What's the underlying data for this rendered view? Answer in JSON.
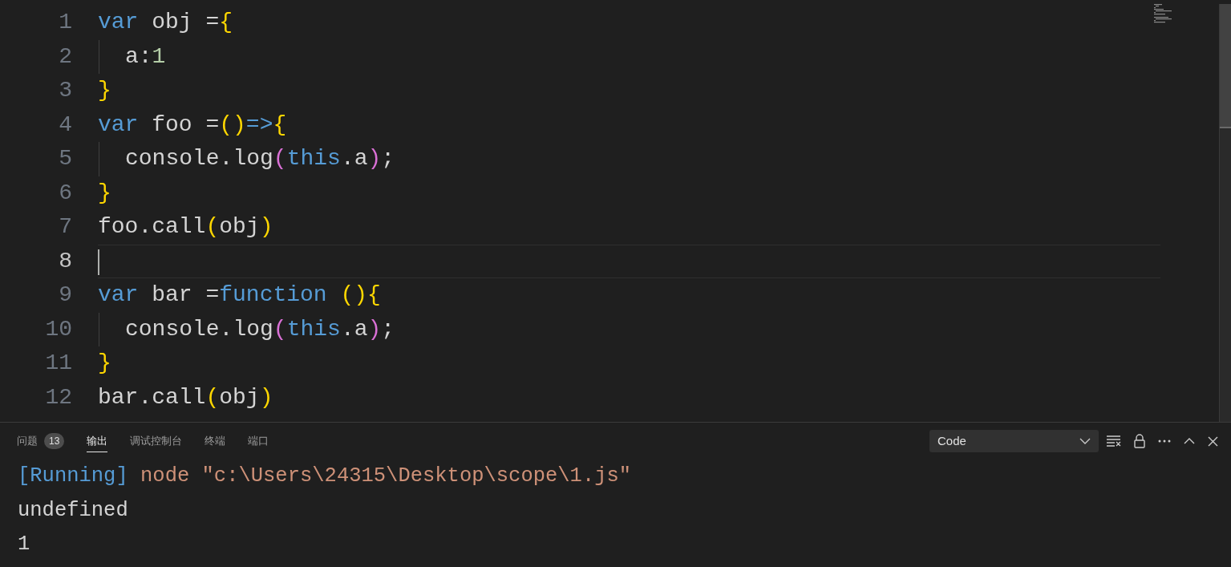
{
  "editor": {
    "lines": [
      {
        "number": "1",
        "current": false,
        "indented": false,
        "tokens": [
          {
            "text": "var",
            "kind": "keyword"
          },
          {
            "text": " obj =",
            "kind": "plain"
          },
          {
            "text": "{",
            "kind": "bracket"
          }
        ]
      },
      {
        "number": "2",
        "current": false,
        "indented": true,
        "tokens": [
          {
            "text": "a:",
            "kind": "plain"
          },
          {
            "text": "1",
            "kind": "number"
          }
        ]
      },
      {
        "number": "3",
        "current": false,
        "indented": false,
        "tokens": [
          {
            "text": "}",
            "kind": "bracket"
          }
        ]
      },
      {
        "number": "4",
        "current": false,
        "indented": false,
        "tokens": [
          {
            "text": "var",
            "kind": "keyword"
          },
          {
            "text": " foo =",
            "kind": "plain"
          },
          {
            "text": "()",
            "kind": "bracket"
          },
          {
            "text": "=>",
            "kind": "keyword"
          },
          {
            "text": "{",
            "kind": "bracket"
          }
        ]
      },
      {
        "number": "5",
        "current": false,
        "indented": true,
        "tokens": [
          {
            "text": "console.log",
            "kind": "plain"
          },
          {
            "text": "(",
            "kind": "bracket2"
          },
          {
            "text": "this",
            "kind": "keyword"
          },
          {
            "text": ".a",
            "kind": "plain"
          },
          {
            "text": ")",
            "kind": "bracket2"
          },
          {
            "text": ";",
            "kind": "plain"
          }
        ]
      },
      {
        "number": "6",
        "current": false,
        "indented": false,
        "tokens": [
          {
            "text": "}",
            "kind": "bracket"
          }
        ]
      },
      {
        "number": "7",
        "current": false,
        "indented": false,
        "tokens": [
          {
            "text": "foo.call",
            "kind": "plain"
          },
          {
            "text": "(",
            "kind": "bracket"
          },
          {
            "text": "obj",
            "kind": "plain"
          },
          {
            "text": ")",
            "kind": "bracket"
          }
        ]
      },
      {
        "number": "8",
        "current": true,
        "indented": false
      },
      {
        "number": "9",
        "current": false,
        "indented": false,
        "tokens": [
          {
            "text": "var",
            "kind": "keyword"
          },
          {
            "text": " bar =",
            "kind": "plain"
          },
          {
            "text": "function",
            "kind": "keyword"
          },
          {
            "text": " (){",
            "kind": "bracket"
          }
        ]
      },
      {
        "number": "10",
        "current": false,
        "indented": true,
        "tokens": [
          {
            "text": "console.log",
            "kind": "plain"
          },
          {
            "text": "(",
            "kind": "bracket2"
          },
          {
            "text": "this",
            "kind": "keyword"
          },
          {
            "text": ".a",
            "kind": "plain"
          },
          {
            "text": ")",
            "kind": "bracket2"
          },
          {
            "text": ";",
            "kind": "plain"
          }
        ]
      },
      {
        "number": "11",
        "current": false,
        "indented": false,
        "tokens": [
          {
            "text": "}",
            "kind": "bracket"
          }
        ]
      },
      {
        "number": "12",
        "current": false,
        "indented": false,
        "tokens": [
          {
            "text": "bar.call",
            "kind": "plain"
          },
          {
            "text": "(",
            "kind": "bracket"
          },
          {
            "text": "obj",
            "kind": "plain"
          },
          {
            "text": ")",
            "kind": "bracket"
          }
        ]
      }
    ]
  },
  "panel": {
    "tabs": [
      {
        "label": "问题",
        "badge": "13",
        "selected": false
      },
      {
        "label": "输出",
        "selected": true
      },
      {
        "label": "调试控制台",
        "selected": false
      },
      {
        "label": "终端",
        "selected": false
      },
      {
        "label": "端口",
        "selected": false
      }
    ],
    "output_channel": "Code",
    "output": [
      [
        {
          "text": "[Running]",
          "kind": "info"
        },
        {
          "text": " node \"c:\\Users\\24315\\Desktop\\scope\\1.js\"",
          "kind": "string"
        }
      ],
      [
        {
          "text": "undefined",
          "kind": "plain"
        }
      ],
      [
        {
          "text": "1",
          "kind": "plain"
        }
      ]
    ]
  }
}
